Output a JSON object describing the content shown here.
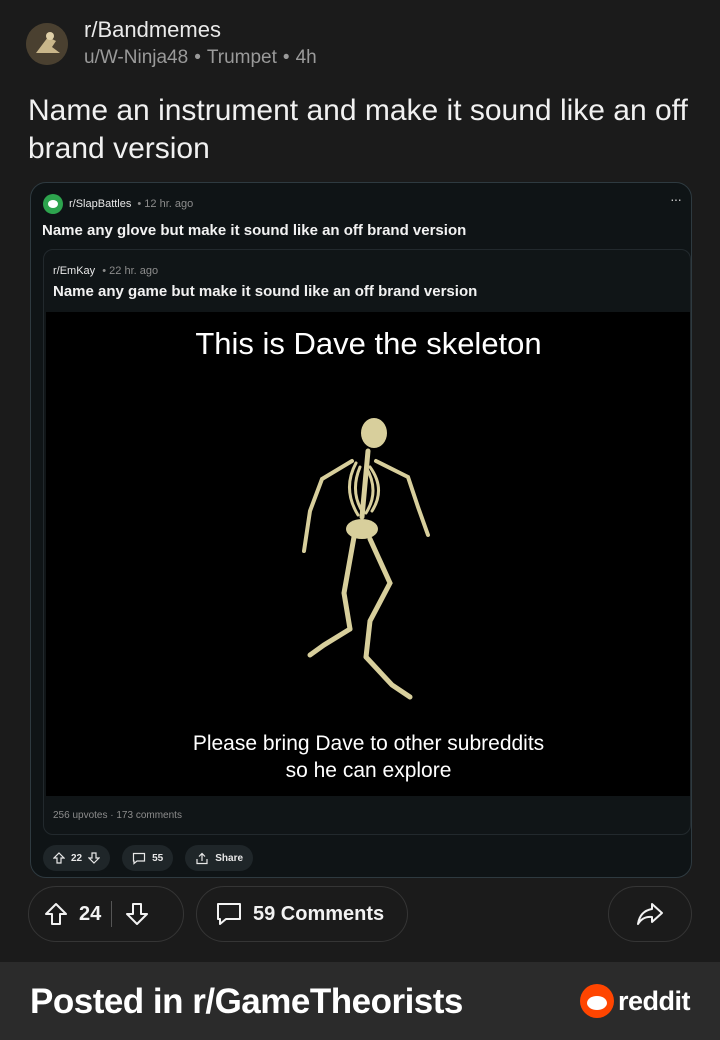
{
  "post": {
    "subreddit": "r/Bandmemes",
    "author": "u/W-Ninja48",
    "flair": "Trumpet",
    "age": "4h",
    "title": "Name an instrument and make it sound like an off brand version",
    "upvotes": "24",
    "comments_label": "59 Comments",
    "icons": [
      "avatar",
      "upvote-icon",
      "downvote-icon",
      "comment-icon",
      "share-icon"
    ]
  },
  "embed": {
    "subreddit": "r/SlapBattles",
    "age": "12 hr. ago",
    "title": "Name any glove but make it sound like an off brand version",
    "more": "···",
    "inner": {
      "subreddit": "r/EmKay",
      "age": "22 hr. ago",
      "title": "Name any game but make it sound like an off brand version",
      "meme_top": "This is Dave the skeleton",
      "meme_bottom_1": "Please bring Dave to other subreddits",
      "meme_bottom_2": "so he can explore",
      "stats": "256 upvotes · 173 comments"
    },
    "votes": "22",
    "comments": "55",
    "share": "Share"
  },
  "footer": {
    "text": "Posted in r/GameTheorists",
    "brand": "reddit"
  },
  "colors": {
    "background": "#1b1b1b",
    "footer": "#2b2b2b",
    "reddit_orange": "#ff4500"
  }
}
